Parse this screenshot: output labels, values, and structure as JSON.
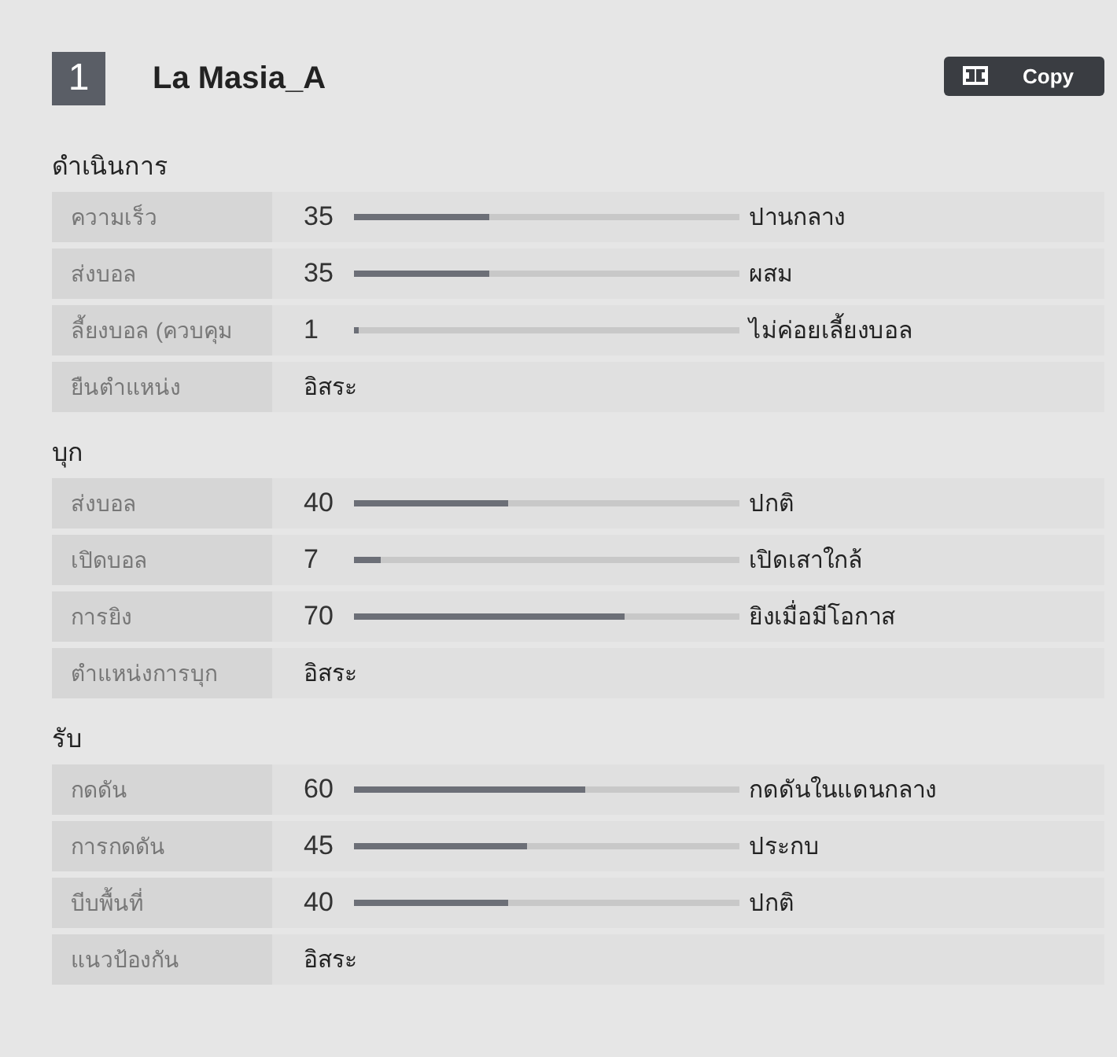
{
  "header": {
    "number": "1",
    "title": "La Masia_A",
    "copy_button": "Copy"
  },
  "sections": [
    {
      "title": "ดำเนินการ",
      "rows": [
        {
          "kind": "slider",
          "label": "ความเร็ว",
          "value": "35",
          "level": 0.35,
          "description": "ปานกลาง"
        },
        {
          "kind": "slider",
          "label": "ส่งบอล",
          "value": "35",
          "level": 0.35,
          "description": "ผสม"
        },
        {
          "kind": "slider",
          "label": "ลี้ยงบอล (ควบคุม",
          "value": "1",
          "level": 0.01,
          "description": "ไม่ค่อยเลี้ยงบอล"
        },
        {
          "kind": "text",
          "label": "ยืนตำแหน่ง",
          "value": "อิสระ"
        }
      ]
    },
    {
      "title": "บุก",
      "rows": [
        {
          "kind": "slider",
          "label": "ส่งบอล",
          "value": "40",
          "level": 0.4,
          "description": "ปกติ"
        },
        {
          "kind": "slider",
          "label": "เปิดบอล",
          "value": "7",
          "level": 0.07,
          "description": "เปิดเสาใกล้"
        },
        {
          "kind": "slider",
          "label": "การยิง",
          "value": "70",
          "level": 0.7,
          "description": "ยิงเมื่อมีโอกาส"
        },
        {
          "kind": "text",
          "label": "ตำแหน่งการบุก",
          "value": "อิสระ"
        }
      ]
    },
    {
      "title": "รับ",
      "rows": [
        {
          "kind": "slider",
          "label": "กดดัน",
          "value": "60",
          "level": 0.6,
          "description": "กดดันในแดนกลาง"
        },
        {
          "kind": "slider",
          "label": "การกดดัน",
          "value": "45",
          "level": 0.45,
          "description": "ประกบ"
        },
        {
          "kind": "slider",
          "label": "บีบพื้นที่",
          "value": "40",
          "level": 0.4,
          "description": "ปกติ"
        },
        {
          "kind": "text",
          "label": "แนวป้องกัน",
          "value": "อิสระ"
        }
      ]
    }
  ]
}
